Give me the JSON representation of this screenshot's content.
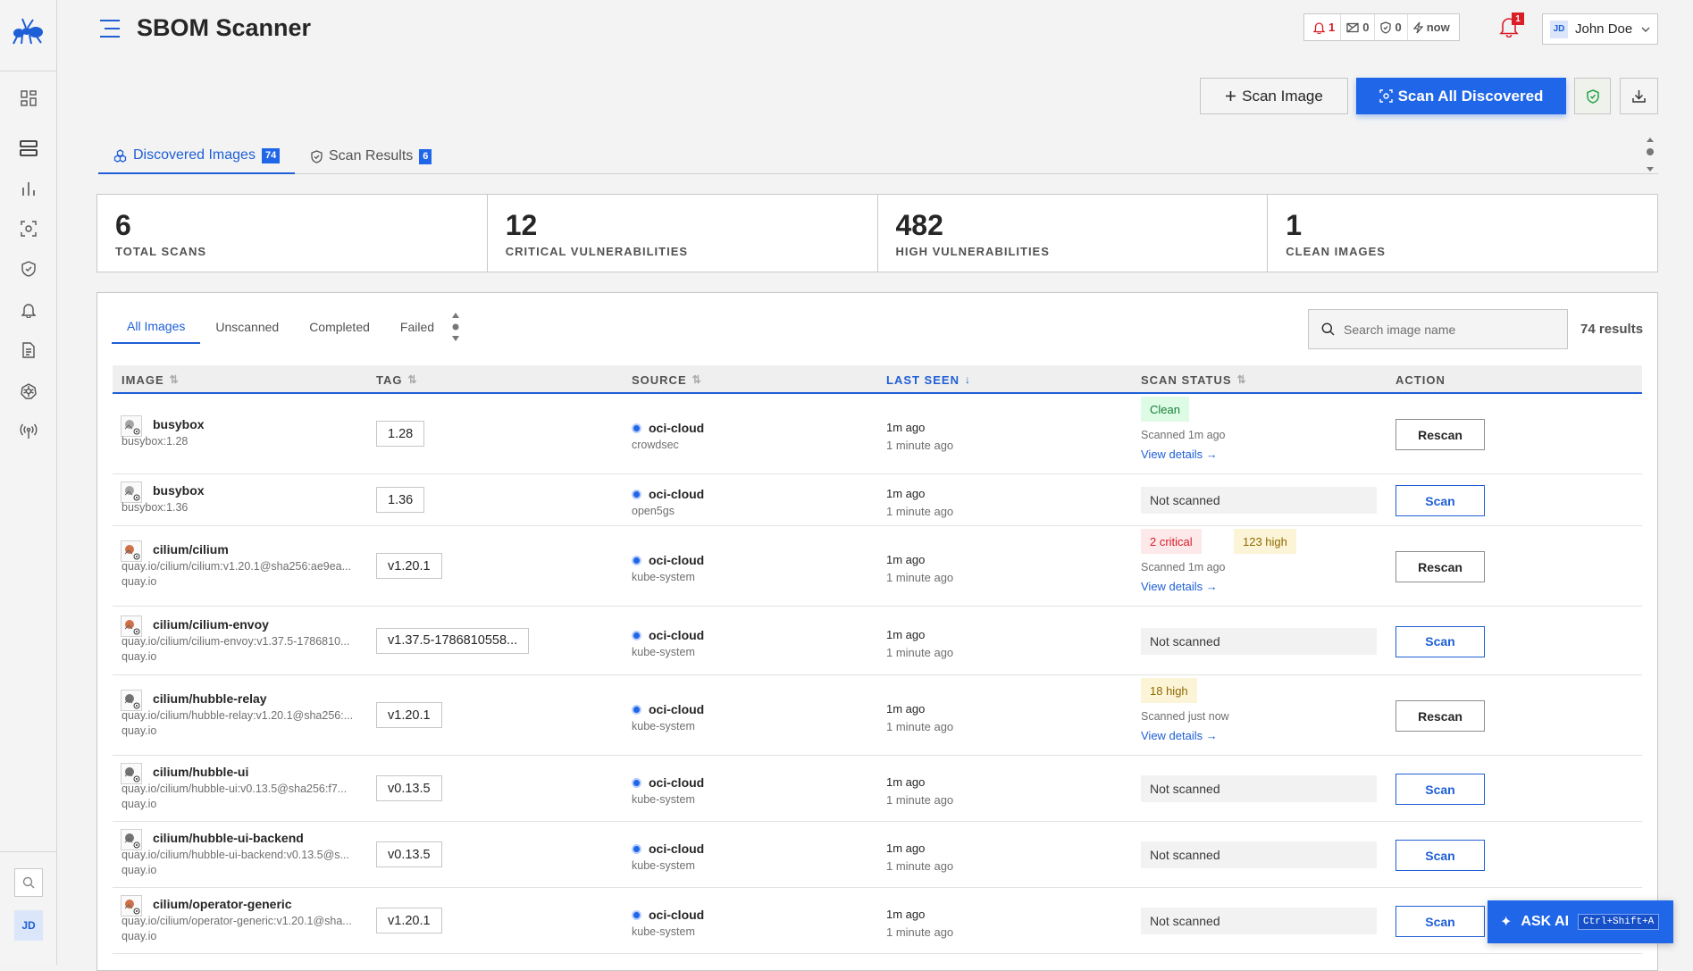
{
  "app": {
    "title": "SBOM Scanner"
  },
  "status": {
    "alerts": "1",
    "messages": "0",
    "shield": "0",
    "sync": "now"
  },
  "notifications": {
    "count": "1"
  },
  "user": {
    "initials": "JD",
    "name": "John Doe"
  },
  "sidebar": {
    "items": [
      "dashboard-icon",
      "servers-icon",
      "chart-icon",
      "scan-icon",
      "shield-icon",
      "bell-icon",
      "document-icon",
      "kubernetes-icon",
      "broadcast-icon"
    ],
    "avatar": "JD"
  },
  "toolbar": {
    "scan_image": "Scan Image",
    "scan_all": "Scan All Discovered"
  },
  "tabs": [
    {
      "label": "Discovered Images",
      "count": "74"
    },
    {
      "label": "Scan Results",
      "count": "6"
    }
  ],
  "stats": [
    {
      "value": "6",
      "label": "TOTAL SCANS"
    },
    {
      "value": "12",
      "label": "CRITICAL VULNERABILITIES"
    },
    {
      "value": "482",
      "label": "HIGH VULNERABILITIES"
    },
    {
      "value": "1",
      "label": "CLEAN IMAGES"
    }
  ],
  "filters": [
    "All Images",
    "Unscanned",
    "Completed",
    "Failed"
  ],
  "search": {
    "placeholder": "Search image name"
  },
  "results": "74 results",
  "columns": [
    "IMAGE",
    "TAG",
    "SOURCE",
    "LAST SEEN",
    "SCAN STATUS",
    "ACTION"
  ],
  "rows": [
    {
      "name": "busybox",
      "ref": "busybox:1.28",
      "registry": "",
      "tag": "1.28",
      "source": "oci-cloud",
      "namespace": "crowdsec",
      "seen": "1m ago",
      "seen_full": "1 minute ago",
      "status": "clean",
      "badges": [
        "Clean"
      ],
      "scanned": "Scanned 1m ago",
      "details": "View details",
      "action": "Rescan"
    },
    {
      "name": "busybox",
      "ref": "busybox:1.36",
      "registry": "",
      "tag": "1.36",
      "source": "oci-cloud",
      "namespace": "open5gs",
      "seen": "1m ago",
      "seen_full": "1 minute ago",
      "status": "none",
      "not_scanned": "Not scanned",
      "action": "Scan"
    },
    {
      "name": "cilium/cilium",
      "ref": "quay.io/cilium/cilium:v1.20.1@sha256:ae9ea...",
      "registry": "quay.io",
      "tag": "v1.20.1",
      "source": "oci-cloud",
      "namespace": "kube-system",
      "seen": "1m ago",
      "seen_full": "1 minute ago",
      "status": "vuln",
      "badges": [
        "2 critical",
        "123 high"
      ],
      "scanned": "Scanned 1m ago",
      "details": "View details",
      "action": "Rescan"
    },
    {
      "name": "cilium/cilium-envoy",
      "ref": "quay.io/cilium/cilium-envoy:v1.37.5-1786810...",
      "registry": "quay.io",
      "tag": "v1.37.5-1786810558...",
      "source": "oci-cloud",
      "namespace": "kube-system",
      "seen": "1m ago",
      "seen_full": "1 minute ago",
      "status": "none",
      "not_scanned": "Not scanned",
      "action": "Scan"
    },
    {
      "name": "cilium/hubble-relay",
      "ref": "quay.io/cilium/hubble-relay:v1.20.1@sha256:...",
      "registry": "quay.io",
      "tag": "v1.20.1",
      "source": "oci-cloud",
      "namespace": "kube-system",
      "seen": "1m ago",
      "seen_full": "1 minute ago",
      "status": "vuln",
      "badges": [
        "18 high"
      ],
      "scanned": "Scanned just now",
      "details": "View details",
      "action": "Rescan"
    },
    {
      "name": "cilium/hubble-ui",
      "ref": "quay.io/cilium/hubble-ui:v0.13.5@sha256:f7...",
      "registry": "quay.io",
      "tag": "v0.13.5",
      "source": "oci-cloud",
      "namespace": "kube-system",
      "seen": "1m ago",
      "seen_full": "1 minute ago",
      "status": "none",
      "not_scanned": "Not scanned",
      "action": "Scan"
    },
    {
      "name": "cilium/hubble-ui-backend",
      "ref": "quay.io/cilium/hubble-ui-backend:v0.13.5@s...",
      "registry": "quay.io",
      "tag": "v0.13.5",
      "source": "oci-cloud",
      "namespace": "kube-system",
      "seen": "1m ago",
      "seen_full": "1 minute ago",
      "status": "none",
      "not_scanned": "Not scanned",
      "action": "Scan"
    },
    {
      "name": "cilium/operator-generic",
      "ref": "quay.io/cilium/operator-generic:v1.20.1@sha...",
      "registry": "quay.io",
      "tag": "v1.20.1",
      "source": "oci-cloud",
      "namespace": "kube-system",
      "seen": "1m ago",
      "seen_full": "1 minute ago",
      "status": "none",
      "not_scanned": "Not scanned",
      "action": "Scan"
    }
  ],
  "ask_ai": {
    "label": "ASK AI",
    "shortcut": "Ctrl+Shift+A"
  }
}
